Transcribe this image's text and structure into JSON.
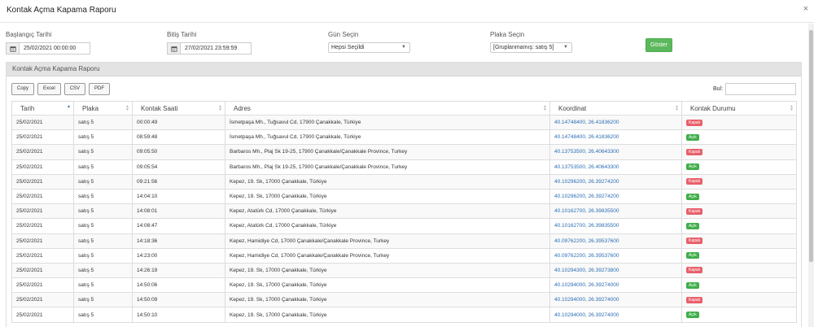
{
  "modal": {
    "title": "Kontak Açma Kapama Raporu",
    "close": "×"
  },
  "filters": {
    "start_label": "Başlangıç Tarihi",
    "start_value": "25/02/2021 00:00:00",
    "end_label": "Bitiş Tarihi",
    "end_value": "27/02/2021 23:59:59",
    "day_label": "Gün Seçin",
    "day_value": "Hepsi Seçildi",
    "plate_label": "Plaka Seçin",
    "plate_value": "[Gruplanmamış: satış 5]",
    "show_button": "Göster"
  },
  "panel": {
    "title": "Kontak Açma Kapama Raporu",
    "export_buttons": [
      "Copy",
      "Excel",
      "CSV",
      "PDF"
    ],
    "search_label": "Bul:",
    "columns": [
      "Tarih",
      "Plaka",
      "Kontak Saati",
      "Adres",
      "Koordinat",
      "Kontak Durumu"
    ]
  },
  "status_colors": {
    "Kapalı": "#e8606a",
    "Açık": "#3fae49"
  },
  "rows": [
    {
      "date": "25/02/2021",
      "plate": "satış 5",
      "time": "00:00:49",
      "address": "İsmetpaşa Mh., Tuğsavul Cd, 17900 Çanakkale, Türkiye",
      "coord": "40.14748400, 26.41836200",
      "status": "Kapalı"
    },
    {
      "date": "25/02/2021",
      "plate": "satış 5",
      "time": "08:59:48",
      "address": "İsmetpaşa Mh., Tuğsavul Cd, 17900 Çanakkale, Türkiye",
      "coord": "40.14748400, 26.41836200",
      "status": "Açık"
    },
    {
      "date": "25/02/2021",
      "plate": "satış 5",
      "time": "09:05:50",
      "address": "Barbaros Mh., Plaj Sk 19-25, 17900 Çanakkale/Çanakkale Province, Turkey",
      "coord": "40.13753500, 26.40643300",
      "status": "Kapalı"
    },
    {
      "date": "25/02/2021",
      "plate": "satış 5",
      "time": "09:05:54",
      "address": "Barbaros Mh., Plaj Sk 19-25, 17900 Çanakkale/Çanakkale Province, Turkey",
      "coord": "40.13753500, 26.40643300",
      "status": "Açık"
    },
    {
      "date": "25/02/2021",
      "plate": "satış 5",
      "time": "09:21:56",
      "address": "Kepez, 19. Sk, 17000 Çanakkale, Türkiye",
      "coord": "40.10296200, 26.39274200",
      "status": "Kapalı"
    },
    {
      "date": "25/02/2021",
      "plate": "satış 5",
      "time": "14:04:10",
      "address": "Kepez, 19. Sk, 17000 Çanakkale, Türkiye",
      "coord": "40.10296200, 26.39274200",
      "status": "Açık"
    },
    {
      "date": "25/02/2021",
      "plate": "satış 5",
      "time": "14:08:01",
      "address": "Kepez, Atatürk Cd, 17000 Çanakkale, Türkiye",
      "coord": "40.10162700, 26.39835500",
      "status": "Kapalı"
    },
    {
      "date": "25/02/2021",
      "plate": "satış 5",
      "time": "14:08:47",
      "address": "Kepez, Atatürk Cd, 17000 Çanakkale, Türkiye",
      "coord": "40.10162700, 26.39835500",
      "status": "Açık"
    },
    {
      "date": "25/02/2021",
      "plate": "satış 5",
      "time": "14:18:36",
      "address": "Kepez, Hamidiye Cd, 17000 Çanakkale/Çanakkale Province, Turkey",
      "coord": "40.09762200, 26.39537600",
      "status": "Kapalı"
    },
    {
      "date": "25/02/2021",
      "plate": "satış 5",
      "time": "14:23:00",
      "address": "Kepez, Hamidiye Cd, 17000 Çanakkale/Çanakkale Province, Turkey",
      "coord": "40.09762200, 26.39537600",
      "status": "Açık"
    },
    {
      "date": "25/02/2021",
      "plate": "satış 5",
      "time": "14:26:19",
      "address": "Kepez, 19. Sk, 17000 Çanakkale, Türkiye",
      "coord": "40.10294300, 26.39273800",
      "status": "Kapalı"
    },
    {
      "date": "25/02/2021",
      "plate": "satış 5",
      "time": "14:50:06",
      "address": "Kepez, 19. Sk, 17000 Çanakkale, Türkiye",
      "coord": "40.10294000, 26.39274000",
      "status": "Açık"
    },
    {
      "date": "25/02/2021",
      "plate": "satış 5",
      "time": "14:50:09",
      "address": "Kepez, 19. Sk, 17000 Çanakkale, Türkiye",
      "coord": "40.10294000, 26.39274000",
      "status": "Kapalı"
    },
    {
      "date": "25/02/2021",
      "plate": "satış 5",
      "time": "14:50:10",
      "address": "Kepez, 19. Sk, 17000 Çanakkale, Türkiye",
      "coord": "40.10294000, 26.39274000",
      "status": "Açık"
    }
  ]
}
